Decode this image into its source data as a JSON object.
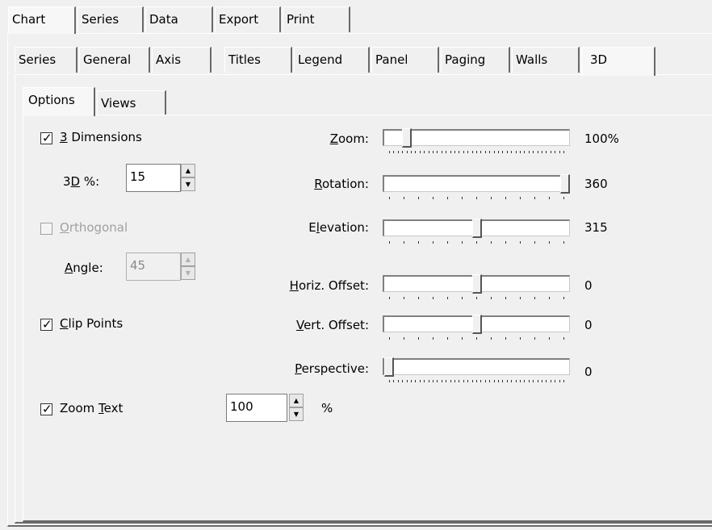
{
  "top_tabs": [
    "Chart",
    "Series",
    "Data",
    "Export",
    "Print"
  ],
  "chart_tabs": [
    "Series",
    "General",
    "Axis",
    "Titles",
    "Legend",
    "Panel",
    "Paging",
    "Walls",
    "3D"
  ],
  "sub_tabs": [
    "Options",
    "Views"
  ],
  "options": {
    "dimensions": {
      "key": "3",
      "rest": " Dimensions",
      "checked": true
    },
    "percent": {
      "prefix": "3",
      "key": "D",
      "suffix": " %:",
      "value": "15"
    },
    "orthogonal": {
      "key": "O",
      "rest": "rthogonal",
      "checked": false
    },
    "angle": {
      "key": "A",
      "rest": "ngle:",
      "value": "45"
    },
    "clip_points": {
      "key": "C",
      "rest": "lip Points",
      "checked": true
    },
    "zoom_text": {
      "prefix": "Zoom ",
      "key": "T",
      "rest": "ext",
      "checked": true,
      "value": "100",
      "unit": "%"
    }
  },
  "sliders": {
    "zoom": {
      "key": "Z",
      "rest": "oom:",
      "value_text": "100%",
      "level": 0.1
    },
    "rotation": {
      "key": "R",
      "rest": "otation:",
      "value_text": "360",
      "level": 1.0
    },
    "elevation": {
      "prefix": "E",
      "key": "l",
      "rest": "evation:",
      "value_text": "315",
      "level": 0.5
    },
    "horiz_offset": {
      "key": "H",
      "rest": "oriz. Offset:",
      "value_text": "0",
      "level": 0.5
    },
    "vert_offset": {
      "key": "V",
      "rest": "ert. Offset:",
      "value_text": "0",
      "level": 0.5
    },
    "perspective": {
      "key": "P",
      "rest": "erspective:",
      "value_text": "0",
      "level": 0.0
    }
  }
}
